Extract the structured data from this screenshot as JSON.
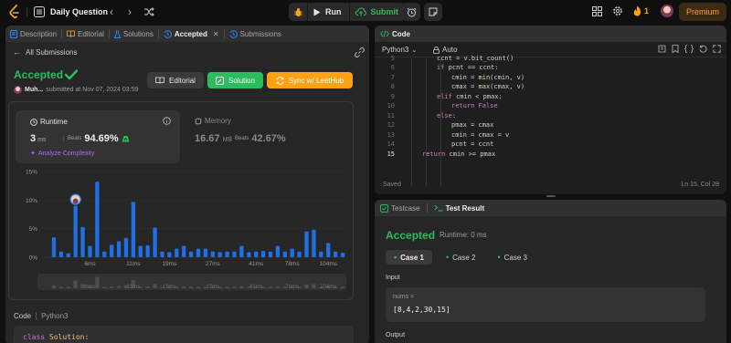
{
  "header": {
    "title": "Daily Question",
    "run_label": "Run",
    "submit_label": "Submit",
    "streak_count": "1",
    "premium_label": "Premium"
  },
  "left": {
    "tabs": [
      {
        "label": "Description"
      },
      {
        "label": "Editorial"
      },
      {
        "label": "Solutions"
      },
      {
        "label": "Accepted"
      },
      {
        "label": "Submissions"
      }
    ],
    "back_label": "All Submissions",
    "status": "Accepted",
    "user": "Muh...",
    "submitted_at": "submitted at Nov 07, 2024 03:59",
    "buttons": {
      "editorial": "Editorial",
      "solution": "Solution",
      "sync": "Sync w/ LeetHub"
    },
    "runtime": {
      "label": "Runtime",
      "value": "3",
      "unit": "ms",
      "beats_label": "Beats",
      "beats": "94.69%",
      "analyze": "Analyze Complexity"
    },
    "memory": {
      "label": "Memory",
      "value": "16.67",
      "unit": "MB",
      "beats_label": "Beats",
      "beats": "42.67%"
    },
    "code_label": "Code",
    "code_lang": "Python3",
    "code_preview_kw": "class",
    "code_preview_name": "Solution:"
  },
  "chart_data": {
    "type": "bar",
    "xlabel": "",
    "ylabel": "",
    "ylim": [
      0,
      15
    ],
    "y_ticks": [
      "15%",
      "10%",
      "5%",
      "0%"
    ],
    "x_ticks": [
      "6ms",
      "11ms",
      "19ms",
      "27ms",
      "41ms",
      "78ms",
      "104ms"
    ],
    "values": [
      3.5,
      1.0,
      0.7,
      9.0,
      5.3,
      2.0,
      13.2,
      1.0,
      2.2,
      2.8,
      3.4,
      9.7,
      2.0,
      2.1,
      5.2,
      1.0,
      0.9,
      1.5,
      2.0,
      1.0,
      1.5,
      1.5,
      1.0,
      0.9,
      1.0,
      1.0,
      2.0,
      0.9,
      1.0,
      1.1,
      1.0,
      2.0,
      1.0,
      1.5,
      1.0,
      4.5,
      4.8,
      1.0,
      2.5,
      1.0,
      0.8
    ],
    "highlight_index": 3,
    "colors": {
      "bar": "#1f6fe5",
      "grid": "#3a3a3a",
      "overview": "#4d4d4d"
    }
  },
  "code": {
    "header": "Code",
    "language": "Python3",
    "auto": "Auto",
    "lines": [
      {
        "n": "5",
        "indent": 3,
        "parts": [
          [
            "vr",
            "ccnt = v.bit_count()"
          ]
        ]
      },
      {
        "n": "6",
        "indent": 3,
        "parts": [
          [
            "kw",
            "if "
          ],
          [
            "vr",
            "pcnt == ccnt:"
          ]
        ]
      },
      {
        "n": "7",
        "indent": 4,
        "parts": [
          [
            "vr",
            "cmin = "
          ],
          [
            "fn",
            "min"
          ],
          [
            "vr",
            "(cmin, v)"
          ]
        ]
      },
      {
        "n": "8",
        "indent": 4,
        "parts": [
          [
            "vr",
            "cmax = "
          ],
          [
            "fn",
            "max"
          ],
          [
            "vr",
            "(cmax, v)"
          ]
        ]
      },
      {
        "n": "9",
        "indent": 3,
        "parts": [
          [
            "kw",
            "elif "
          ],
          [
            "vr",
            "cmin < pmax:"
          ]
        ]
      },
      {
        "n": "10",
        "indent": 4,
        "parts": [
          [
            "kw",
            "return "
          ],
          [
            "kw",
            "False"
          ]
        ]
      },
      {
        "n": "11",
        "indent": 3,
        "parts": [
          [
            "kw",
            "else"
          ],
          [
            "vr",
            ":"
          ]
        ]
      },
      {
        "n": "12",
        "indent": 4,
        "parts": [
          [
            "vr",
            "pmax = cmax"
          ]
        ]
      },
      {
        "n": "13",
        "indent": 4,
        "parts": [
          [
            "vr",
            "cmin = cmax = v"
          ]
        ]
      },
      {
        "n": "14",
        "indent": 4,
        "parts": [
          [
            "vr",
            "pcnt = ccnt"
          ]
        ]
      },
      {
        "n": "15",
        "indent": 2,
        "parts": [
          [
            "kw",
            "return "
          ],
          [
            "vr",
            "cmin >= pmax"
          ]
        ]
      }
    ],
    "saved": "Saved",
    "cursor": "Ln 15, Col 28"
  },
  "test": {
    "tab_testcase": "Testcase",
    "tab_result": "Test Result",
    "status": "Accepted",
    "runtime": "Runtime: 0 ms",
    "cases": [
      "Case 1",
      "Case 2",
      "Case 3"
    ],
    "input_label": "Input",
    "var_name": "nums =",
    "var_value": "[8,4,2,30,15]",
    "output_label": "Output"
  }
}
